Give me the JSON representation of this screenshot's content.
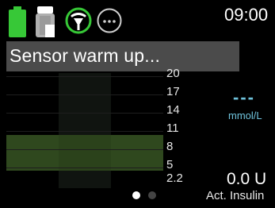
{
  "status": {
    "time": "09:00",
    "icons": [
      "battery-icon",
      "reservoir-icon",
      "sensor-icon",
      "more-icon"
    ]
  },
  "banner": {
    "message": "Sensor warm up..."
  },
  "graph": {
    "y_ticks": [
      "20",
      "17",
      "14",
      "11",
      "8",
      "5",
      "2.2"
    ]
  },
  "sensor": {
    "value": "---",
    "unit": "mmol/L"
  },
  "insulin": {
    "value": "0.0 U",
    "label": "Act. Insulin"
  },
  "pager": {
    "pages": 2,
    "active": 1
  },
  "colors": {
    "accent": "#6fc3dc",
    "ok_green": "#32c832",
    "banner": "#4b4b4b"
  }
}
